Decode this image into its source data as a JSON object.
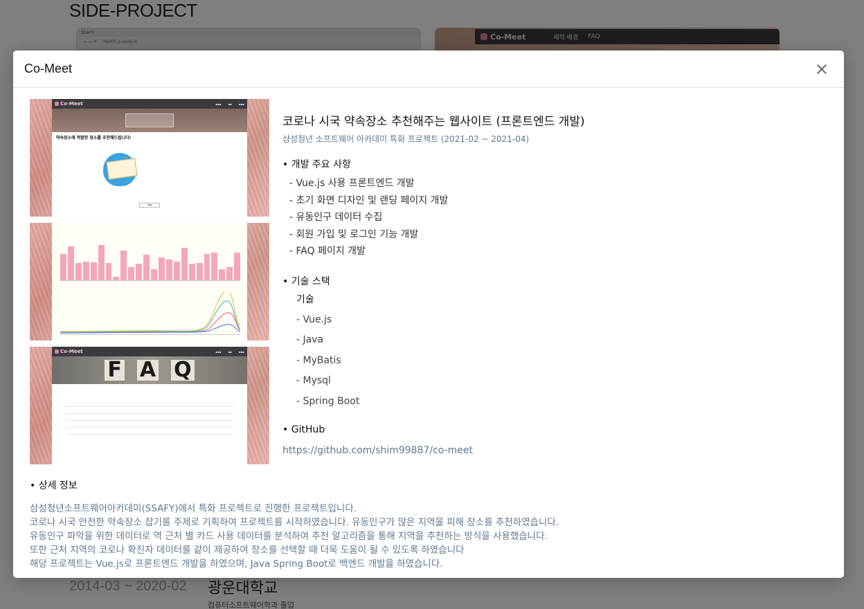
{
  "background": {
    "section_title": "SIDE-PROJECT",
    "left_shot": {
      "tab_label": "SSAFY",
      "url": "i4a305.p.ssafy.io"
    },
    "right_shot": {
      "logo": "Co-Meet",
      "nav_links": [
        "제작 배경",
        "FAQ"
      ]
    },
    "education_date": "2014-03 ~ 2020-02",
    "education_school": "광운대학교",
    "education_major": "컴퓨터소프트웨어학과 졸업"
  },
  "modal": {
    "title": "Co-Meet",
    "screenshots": {
      "logo": "Co-Meet",
      "shot1_heading": "약속장소에 적합한 장소를 추천해드립니다!",
      "shot3_letters": [
        "F",
        "A",
        "Q"
      ]
    },
    "project_title": "코로나 시국 약속장소 추천해주는 웹사이트 (프론트엔드 개발)",
    "project_subtitle": "삼성청년 소프트웨어 아카데미 특화 프로젝트 (2021-02 ~ 2021-04)",
    "dev_section_title": "개발 주요 사항",
    "dev_items": [
      "- Vue.js 사용 프론트엔드 개발",
      "- 초기 화면 디자인 및 랜딩 페이지 개발",
      "- 유동인구 데이터 수집",
      "- 회원 가입 및 로그인 기능 개발",
      "- FAQ 페이지 개발"
    ],
    "stack_section_title": "기술 스택",
    "stack_heading": "기술",
    "stack_items": [
      "- Vue.js",
      "- Java",
      "- MyBatis",
      "- Mysql",
      "- Spring Boot"
    ],
    "github_section_title": "GitHub",
    "github_url": "https://github.com/shim99887/co-meet",
    "detail_section_title": "상세 정보",
    "detail_lines": [
      "삼성청년소프트웨어아카데미(SSAFY)에서 특화 프로젝트로 진행한 프로젝트입니다.",
      "코로나 시국 안전한 약속장소 잡기를 주제로 기획하여 프로젝트를 시작하였습니다. 유동인구가 많은 지역을 피해 장소를 추천하였습니다.",
      "유동인구 파악을 위한 데이터로 역 근처 별 카드 사용 데이터를 분석하여 추천 알고리즘을 통해 지역을 추천하는 방식을 사용했습니다.",
      "또한 근처 지역의 코로나 확진자 데이터를 같이 제공하여 장소를 선택할 때 더욱 도움이 될 수 있도록 하였습니다",
      "해당 프로젝트는 Vue.js로 프론트엔드 개발을 하였으며, Java Spring Boot로 백엔드 개발을 하였습니다."
    ],
    "accent_color": "#5d7891",
    "close_icon": "close-icon"
  }
}
